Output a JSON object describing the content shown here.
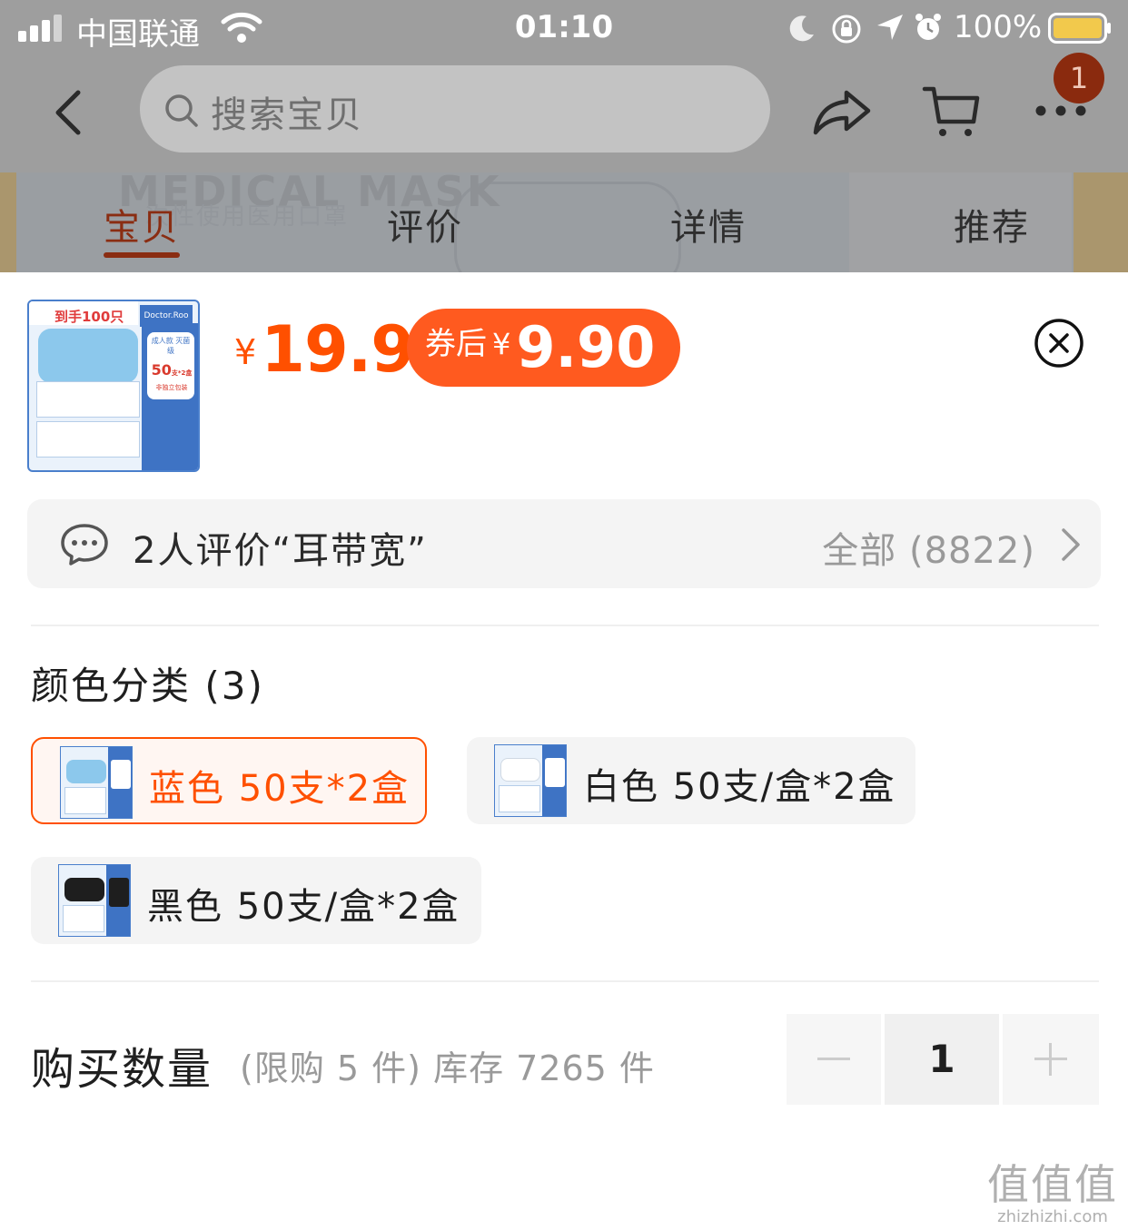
{
  "status_bar": {
    "carrier": "中国联通",
    "time": "01:10",
    "battery_percent": "100%",
    "battery_color": "#f2c94c",
    "icons": [
      "signal-icon",
      "wifi-icon",
      "moon-icon",
      "orientation-lock-icon",
      "location-icon",
      "alarm-icon",
      "battery-icon"
    ]
  },
  "nav": {
    "search_placeholder": "搜索宝贝",
    "badge_count": "1"
  },
  "hero_text": {
    "line1": "MEDICAL MASK",
    "line2": "次性使用医用口罩"
  },
  "tabs": [
    {
      "label": "宝贝",
      "active": true
    },
    {
      "label": "评价",
      "active": false
    },
    {
      "label": "详情",
      "active": false
    },
    {
      "label": "推荐",
      "active": false
    }
  ],
  "product": {
    "thumb_banner": "到手100只",
    "thumb_brand": "Doctor.Roo 袋鼠医生",
    "thumb_card_title": "成人款 灭菌级",
    "thumb_card_num": "50",
    "thumb_card_unit": "支*2盒",
    "thumb_card_sub": "非独立包装",
    "currency": "¥",
    "price": "19.9",
    "coupon_label": "券后",
    "coupon_currency": "¥",
    "coupon_price": "9.90",
    "accent_color": "#ff5000"
  },
  "reviews": {
    "summary": "2人评价“耳带宽”",
    "all_label": "全部 (8822)"
  },
  "color_section": {
    "title": "颜色分类 (3)",
    "options": [
      {
        "label": "蓝色 50支*2盒",
        "selected": true,
        "mask_color": "#8cc8ec"
      },
      {
        "label": "白色 50支/盒*2盒",
        "selected": false,
        "mask_color": "#ffffff"
      },
      {
        "label": "黑色 50支/盒*2盒",
        "selected": false,
        "mask_color": "#1e1e1e"
      }
    ]
  },
  "quantity": {
    "label": "购买数量",
    "note": "(限购 5 件) 库存 7265 件",
    "value": "1"
  },
  "watermark": {
    "logo": "值值值",
    "url": "zhizhizhi.com"
  }
}
